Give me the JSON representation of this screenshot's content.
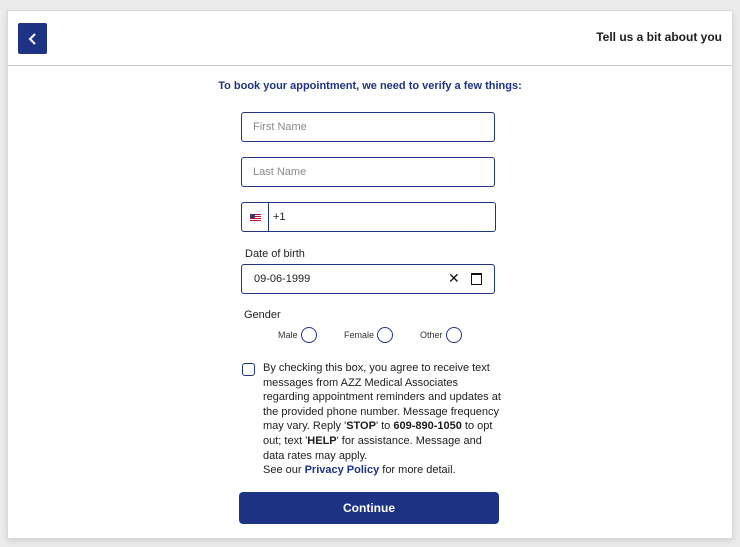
{
  "header": {
    "title": "Tell us a bit about you",
    "back_icon": "chevron-left-icon"
  },
  "intro": "To book your appointment, we need to verify a few things:",
  "form": {
    "first_name_placeholder": "First Name",
    "last_name_placeholder": "Last Name",
    "phone": {
      "country_flag": "us-flag-icon",
      "value": "+1"
    },
    "dob": {
      "label": "Date of birth",
      "value": "09-06-1999",
      "clear_icon": "close-icon",
      "calendar_icon": "calendar-icon"
    },
    "gender": {
      "label": "Gender",
      "options": [
        "Male",
        "Female",
        "Other"
      ]
    },
    "consent": {
      "part1": "By checking this box, you agree to receive text messages from AZZ Medical Associates regarding appointment reminders and updates at the provided phone number. Message frequency may vary. Reply '",
      "stop": "STOP",
      "part2": "' to ",
      "phone_number": "609-890-1050",
      "part3": " to opt out; text '",
      "help": "HELP",
      "part4": "' for assistance. Message and data rates may apply.",
      "see_our": "See our ",
      "policy_link": "Privacy Policy",
      "more_detail": " for more detail."
    },
    "continue_label": "Continue"
  },
  "colors": {
    "primary": "#1f3384",
    "border": "#c8c8c8",
    "background": "#ececec"
  }
}
